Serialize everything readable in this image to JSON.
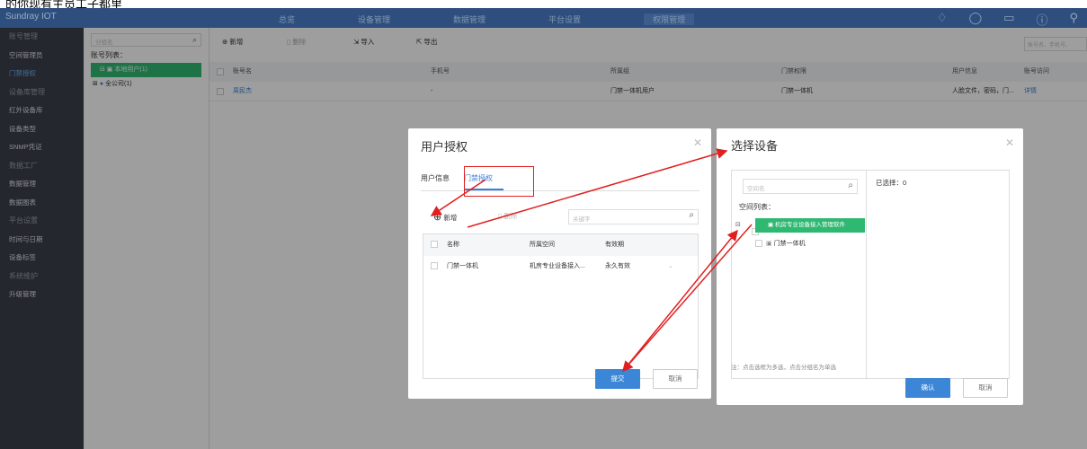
{
  "caption": "的你现有主员工子都里",
  "app": {
    "brand": "Sundray IOT",
    "nav": [
      "总览",
      "设备管理",
      "数据管理",
      "平台设置",
      "权限管理"
    ]
  },
  "sidebar": {
    "items": [
      {
        "label": "账号管理",
        "group": true
      },
      {
        "label": "空间管理员"
      },
      {
        "label": "门禁授权",
        "active": true
      },
      {
        "label": "设备库管理",
        "group": true
      },
      {
        "label": "红外设备库"
      },
      {
        "label": "设备类型"
      },
      {
        "label": "SNMP凭证"
      },
      {
        "label": "数据工厂",
        "group": true
      },
      {
        "label": "数据管理"
      },
      {
        "label": "数据图表"
      },
      {
        "label": "平台设置",
        "group": true
      },
      {
        "label": "时间与日期"
      },
      {
        "label": "设备标签"
      },
      {
        "label": "系统维护",
        "group": true
      },
      {
        "label": "升级管理"
      }
    ]
  },
  "midpanel": {
    "search_placeholder": "分组名",
    "list_title": "账号列表：",
    "nodes": [
      "本地用户(1)",
      "全公司(1)"
    ]
  },
  "toolbar": {
    "add": "新增",
    "delete": "删除",
    "import": "导入",
    "export": "导出",
    "search_placeholder": "账号名、手机号、"
  },
  "table": {
    "headers": [
      "账号名",
      "手机号",
      "所属组",
      "门禁权限",
      "用户信息",
      "账号访问"
    ],
    "rows": [
      [
        "周民杰",
        "-",
        "门禁一体机用户",
        "门禁一体机",
        "人脸文件，密码，门...",
        "详情"
      ]
    ]
  },
  "dialog_auth": {
    "title": "用户授权",
    "tabs": [
      "用户信息",
      "门禁授权"
    ],
    "add": "新增",
    "delete": "删除",
    "search_placeholder": "关键字",
    "headers": [
      "名称",
      "所属空间",
      "有效期"
    ],
    "rows": [
      [
        "门禁一体机",
        "机房专业设备接入...",
        "永久有效"
      ]
    ],
    "submit": "提交",
    "cancel": "取消"
  },
  "dialog_device": {
    "title": "选择设备",
    "search_placeholder": "空间名",
    "list_title": "空间列表：",
    "root": "机房专业设备接入管理软件",
    "child": "门禁一体机",
    "selected": "已选择：0",
    "note": "注：点击选框为多选，点击分组名为单选",
    "confirm": "确认",
    "cancel": "取消"
  }
}
